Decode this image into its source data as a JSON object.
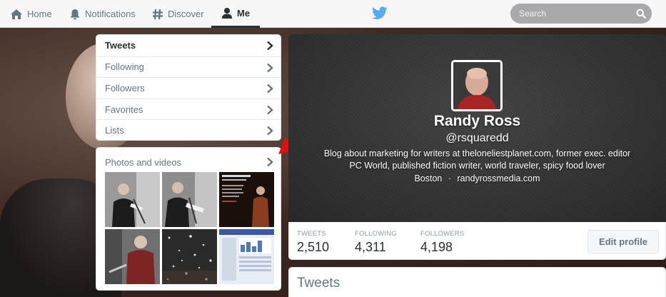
{
  "nav": {
    "items": [
      {
        "label": "Home",
        "icon": "home-icon"
      },
      {
        "label": "Notifications",
        "icon": "bell-icon"
      },
      {
        "label": "Discover",
        "icon": "hash-icon"
      },
      {
        "label": "Me",
        "icon": "person-icon",
        "active": true
      }
    ],
    "logo": "twitter-bird-icon",
    "search_placeholder": "Search"
  },
  "sidebar": {
    "items": [
      {
        "label": "Tweets",
        "selected": true
      },
      {
        "label": "Following"
      },
      {
        "label": "Followers"
      },
      {
        "label": "Favorites"
      },
      {
        "label": "Lists"
      }
    ]
  },
  "photos": {
    "title": "Photos and videos",
    "thumb_count": 6
  },
  "profile": {
    "name": "Randy Ross",
    "handle": "@rsquaredd",
    "bio_line1": "Blog about marketing for writers at theloneliestplanet.com, former exec. editor",
    "bio_line2": "PC World, published fiction writer, world traveler, spicy food lover",
    "location": "Boston",
    "separator": "·",
    "website": "randyrossmedia.com"
  },
  "stats": {
    "tweets_label": "TWEETS",
    "tweets_value": "2,510",
    "following_label": "FOLLOWING",
    "following_value": "4,311",
    "followers_label": "FOLLOWERS",
    "followers_value": "4,198",
    "edit_button": "Edit profile"
  },
  "timeline": {
    "title": "Tweets"
  },
  "colors": {
    "twitter_blue": "#55acee",
    "annotation_arrow": "#e01010"
  }
}
